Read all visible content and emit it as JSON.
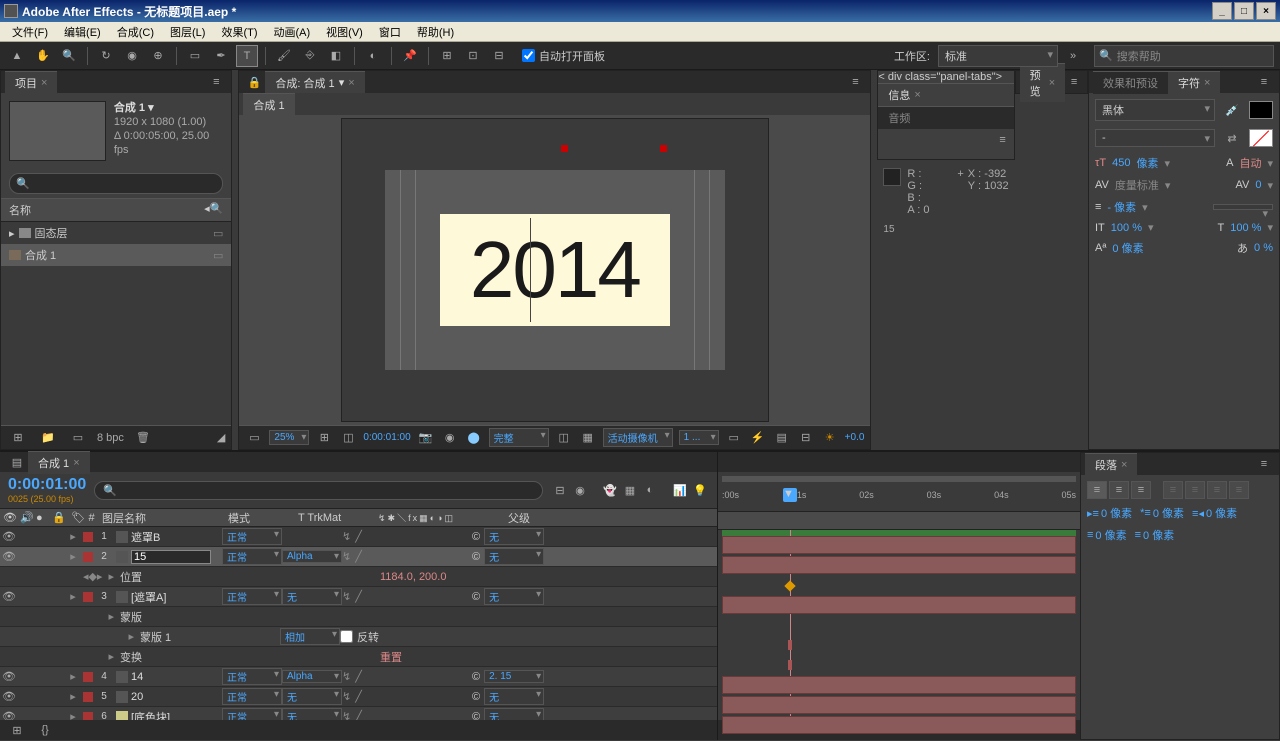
{
  "title": "Adobe After Effects - 无标题项目.aep *",
  "menus": [
    "文件(F)",
    "编辑(E)",
    "合成(C)",
    "图层(L)",
    "效果(T)",
    "动画(A)",
    "视图(V)",
    "窗口",
    "帮助(H)"
  ],
  "toolbar": {
    "auto_open": "自动打开面板",
    "workspace_label": "工作区:",
    "workspace_value": "标准",
    "search_placeholder": "搜索帮助"
  },
  "project": {
    "tab": "项目",
    "comp_name": "合成 1 ▾",
    "comp_res": "1920 x 1080 (1.00)",
    "comp_dur": "Δ 0:00:05:00, 25.00 fps",
    "name_col": "名称",
    "items": [
      {
        "name": "固态层",
        "type": "folder"
      },
      {
        "name": "合成 1",
        "type": "comp",
        "selected": true
      }
    ],
    "bpc": "8 bpc"
  },
  "composition": {
    "tab_outer": "合成: 合成 1",
    "tab_inner": "合成 1",
    "canvas_text": "2014",
    "zoom": "25%",
    "timecode": "0:00:01:00",
    "quality": "完整",
    "camera": "活动摄像机",
    "views": "1 ...",
    "exposure": "+0.0"
  },
  "info": {
    "tab1": "信息",
    "tab2": "音频",
    "r": "R :",
    "g": "G :",
    "b": "B :",
    "a": "A :  0",
    "x": "X : -392",
    "y": "Y :  1032",
    "frame": "15"
  },
  "preview": {
    "tab": "预览"
  },
  "effects": {
    "tab1": "效果和预设",
    "tab2": "字符"
  },
  "character": {
    "font": "黑体",
    "size": "450",
    "size_unit": "像素",
    "leading": "自动",
    "kern": "度量标准",
    "stroke": "- 像素",
    "vscale": "100 %",
    "hscale": "100 %",
    "baseline": "0 像素",
    "tsume": "0 %"
  },
  "paragraph": {
    "tab": "段落",
    "indents": [
      "0 像素",
      "0 像素",
      "0 像素"
    ],
    "space": [
      "0 像素",
      "0 像素"
    ]
  },
  "timeline": {
    "tab": "合成 1",
    "timecode": "0:00:01:00",
    "frames": "0025 (25.00 fps)",
    "cols": {
      "name": "图层名称",
      "mode": "模式",
      "trkmat": "T   TrkMat",
      "parent": "父级"
    },
    "ruler": [
      ":00s",
      "01s",
      "02s",
      "03s",
      "04s",
      "05s"
    ],
    "layers": [
      {
        "idx": "1",
        "name": "遮罩B",
        "mode": "正常",
        "trk": "",
        "parent": "无",
        "bar": true
      },
      {
        "idx": "2",
        "name": "15",
        "mode": "正常",
        "trk": "Alpha",
        "parent": "无",
        "bar": true,
        "editing": true,
        "sel": true
      },
      {
        "prop": "位置",
        "val": "1184.0, 200.0",
        "sub": true
      },
      {
        "idx": "3",
        "name": "[遮罩A]",
        "mode": "正常",
        "trk": "无",
        "parent": "无",
        "bar": true
      },
      {
        "prop": "蒙版",
        "sub": true
      },
      {
        "prop": "蒙版 1",
        "mode": "相加",
        "invert": "反转",
        "sub": true,
        "indent": 2
      },
      {
        "prop": "变换",
        "val": "重置",
        "sub": true
      },
      {
        "idx": "4",
        "name": "14",
        "mode": "正常",
        "trk": "Alpha",
        "parent": "2. 15",
        "bar": true
      },
      {
        "idx": "5",
        "name": "20",
        "mode": "正常",
        "trk": "无",
        "parent": "无",
        "bar": true
      },
      {
        "idx": "6",
        "name": "[底色块]",
        "mode": "正常",
        "trk": "无",
        "parent": "无",
        "bar": true
      }
    ]
  }
}
